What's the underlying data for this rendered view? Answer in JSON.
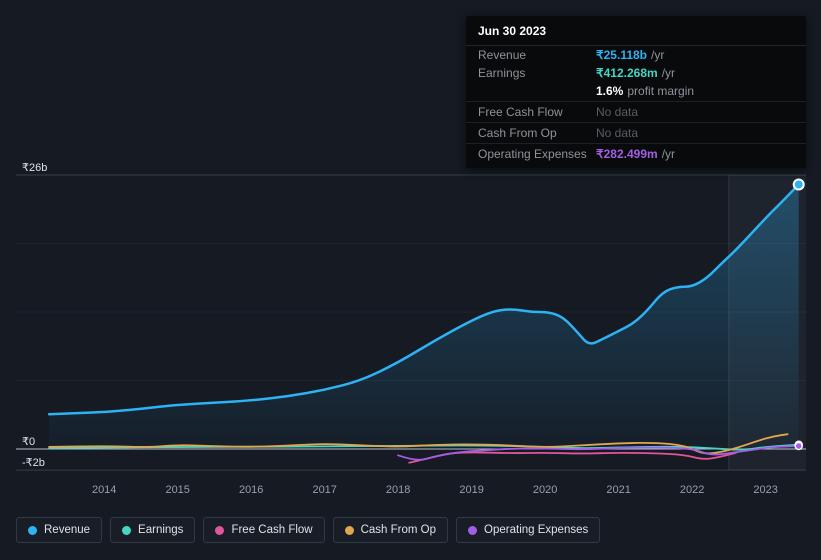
{
  "tooltip": {
    "date": "Jun 30 2023",
    "rows": {
      "revenue": {
        "label": "Revenue",
        "value": "₹25.118b",
        "suffix": "/yr",
        "color": "#2eb2f4"
      },
      "earnings": {
        "label": "Earnings",
        "value": "₹412.268m",
        "suffix": "/yr",
        "color": "#45d6c3",
        "margin_value": "1.6%",
        "margin_label": "profit margin"
      },
      "free_cash_flow": {
        "label": "Free Cash Flow",
        "value": "No data"
      },
      "cash_from_op": {
        "label": "Cash From Op",
        "value": "No data"
      },
      "operating_expenses": {
        "label": "Operating Expenses",
        "value": "₹282.499m",
        "suffix": "/yr",
        "color": "#a45ee5"
      }
    }
  },
  "axis": {
    "y_labels": [
      {
        "label": "₹26b",
        "value": 26
      },
      {
        "label": "₹0",
        "value": 0
      },
      {
        "label": "-₹2b",
        "value": -2
      }
    ],
    "x_years": [
      2014,
      2015,
      2016,
      2017,
      2018,
      2019,
      2020,
      2021,
      2022,
      2023
    ]
  },
  "legend": {
    "items": [
      {
        "label": "Revenue",
        "color": "#2eb2f4"
      },
      {
        "label": "Earnings",
        "color": "#45d6c3"
      },
      {
        "label": "Free Cash Flow",
        "color": "#e0569b"
      },
      {
        "label": "Cash From Op",
        "color": "#e2a64e"
      },
      {
        "label": "Operating Expenses",
        "color": "#a45ee5"
      }
    ]
  },
  "chart_data": {
    "type": "line",
    "title": "",
    "unit": "₹ billions per year",
    "x_range": [
      2012.8,
      2023.55
    ],
    "y_range": [
      -2,
      26
    ],
    "highlight_x_range": [
      2022.5,
      2023.55
    ],
    "grid_minor_values": [
      19.5,
      13,
      6.5
    ],
    "series": [
      {
        "name": "Revenue",
        "color": "#2eb2f4",
        "area": true,
        "points": [
          [
            2013.25,
            3.3
          ],
          [
            2013.6,
            3.4
          ],
          [
            2014,
            3.5
          ],
          [
            2014.5,
            3.8
          ],
          [
            2015,
            4.2
          ],
          [
            2015.5,
            4.4
          ],
          [
            2016,
            4.6
          ],
          [
            2016.5,
            5.0
          ],
          [
            2017,
            5.6
          ],
          [
            2017.5,
            6.5
          ],
          [
            2018,
            8.2
          ],
          [
            2018.5,
            10.3
          ],
          [
            2019,
            12.2
          ],
          [
            2019.3,
            13.1
          ],
          [
            2019.55,
            13.3
          ],
          [
            2019.8,
            13.0
          ],
          [
            2020.05,
            13.0
          ],
          [
            2020.25,
            12.5
          ],
          [
            2020.45,
            11.0
          ],
          [
            2020.6,
            9.8
          ],
          [
            2020.8,
            10.5
          ],
          [
            2021.0,
            11.2
          ],
          [
            2021.2,
            11.9
          ],
          [
            2021.4,
            13.2
          ],
          [
            2021.6,
            14.9
          ],
          [
            2021.8,
            15.4
          ],
          [
            2022.0,
            15.4
          ],
          [
            2022.2,
            16.2
          ],
          [
            2022.4,
            17.6
          ],
          [
            2022.6,
            18.9
          ],
          [
            2022.8,
            20.4
          ],
          [
            2023.0,
            21.9
          ],
          [
            2023.2,
            23.3
          ],
          [
            2023.45,
            25.1
          ]
        ]
      },
      {
        "name": "Earnings",
        "color": "#45d6c3",
        "points": [
          [
            2013.25,
            0.1
          ],
          [
            2014,
            0.15
          ],
          [
            2015,
            0.2
          ],
          [
            2016,
            0.2
          ],
          [
            2017,
            0.25
          ],
          [
            2018,
            0.3
          ],
          [
            2019,
            0.35
          ],
          [
            2019.8,
            0.25
          ],
          [
            2020.5,
            0.05
          ],
          [
            2021,
            0.15
          ],
          [
            2021.8,
            0.25
          ],
          [
            2022.3,
            0.05
          ],
          [
            2022.7,
            -0.1
          ],
          [
            2023,
            0.2
          ],
          [
            2023.45,
            0.41
          ]
        ]
      },
      {
        "name": "Free Cash Flow",
        "color": "#e0569b",
        "points": [
          [
            2018.15,
            -1.3
          ],
          [
            2018.4,
            -0.9
          ],
          [
            2018.7,
            -0.4
          ],
          [
            2019,
            -0.3
          ],
          [
            2019.5,
            -0.4
          ],
          [
            2020,
            -0.35
          ],
          [
            2020.5,
            -0.45
          ],
          [
            2021,
            -0.35
          ],
          [
            2021.5,
            -0.4
          ],
          [
            2021.9,
            -0.55
          ],
          [
            2022.15,
            -1.0
          ],
          [
            2022.35,
            -0.8
          ],
          [
            2022.6,
            -0.35
          ]
        ]
      },
      {
        "name": "Cash From Op",
        "color": "#e2a64e",
        "points": [
          [
            2013.25,
            0.2
          ],
          [
            2014,
            0.3
          ],
          [
            2014.6,
            0.15
          ],
          [
            2015,
            0.4
          ],
          [
            2015.6,
            0.25
          ],
          [
            2016,
            0.2
          ],
          [
            2016.6,
            0.35
          ],
          [
            2017,
            0.5
          ],
          [
            2017.5,
            0.35
          ],
          [
            2018,
            0.2
          ],
          [
            2018.5,
            0.4
          ],
          [
            2019,
            0.45
          ],
          [
            2019.5,
            0.35
          ],
          [
            2020,
            0.15
          ],
          [
            2020.5,
            0.35
          ],
          [
            2021,
            0.55
          ],
          [
            2021.5,
            0.6
          ],
          [
            2021.9,
            0.35
          ],
          [
            2022.15,
            -0.5
          ],
          [
            2022.4,
            -0.3
          ],
          [
            2022.7,
            0.3
          ],
          [
            2022.9,
            0.8
          ],
          [
            2023.1,
            1.2
          ],
          [
            2023.3,
            1.4
          ]
        ]
      },
      {
        "name": "Operating Expenses",
        "color": "#a45ee5",
        "points": [
          [
            2018.0,
            -0.6
          ],
          [
            2018.25,
            -1.2
          ],
          [
            2018.5,
            -0.7
          ],
          [
            2018.8,
            -0.3
          ],
          [
            2019.2,
            -0.1
          ],
          [
            2019.6,
            0.05
          ],
          [
            2020,
            0.05
          ],
          [
            2020.5,
            -0.05
          ],
          [
            2021,
            0.1
          ],
          [
            2021.5,
            0.15
          ],
          [
            2022,
            0.05
          ],
          [
            2022.25,
            -0.6
          ],
          [
            2022.5,
            -0.4
          ],
          [
            2022.8,
            -0.1
          ],
          [
            2023.1,
            0.2
          ],
          [
            2023.45,
            0.28
          ]
        ]
      }
    ],
    "markers": [
      {
        "series": "Revenue",
        "x": 2023.45,
        "y": 25.1
      },
      {
        "series": "Earnings",
        "x": 2023.45,
        "y": 0.41
      },
      {
        "series": "Operating Expenses",
        "x": 2023.45,
        "y": 0.28
      }
    ]
  }
}
